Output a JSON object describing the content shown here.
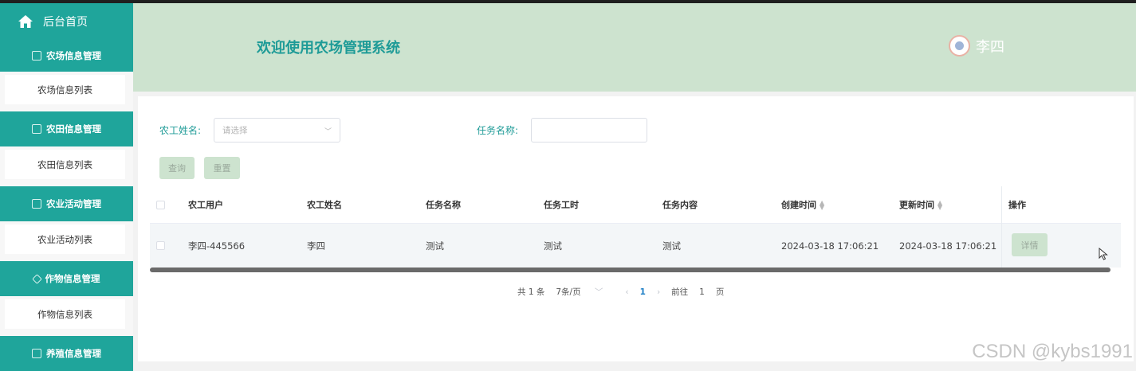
{
  "sidebar": {
    "home_label": "后台首页",
    "groups": [
      {
        "title": "农场信息管理",
        "icon": "edit-icon",
        "item": "农场信息列表"
      },
      {
        "title": "农田信息管理",
        "icon": "chart-icon",
        "item": "农田信息列表"
      },
      {
        "title": "农业活动管理",
        "icon": "edit-icon",
        "item": "农业活动列表"
      },
      {
        "title": "作物信息管理",
        "icon": "gem-icon",
        "item": "作物信息列表"
      },
      {
        "title": "养殖信息管理",
        "icon": "chart-icon"
      }
    ]
  },
  "header": {
    "welcome": "欢迎使用农场管理系统",
    "user_name": "李四"
  },
  "search": {
    "worker_name_label": "农工姓名:",
    "worker_name_placeholder": "请选择",
    "task_name_label": "任务名称:",
    "task_name_value": "",
    "query_label": "查询",
    "reset_label": "重置"
  },
  "table": {
    "columns": [
      "农工用户",
      "农工姓名",
      "任务名称",
      "任务工时",
      "任务内容",
      "创建时间",
      "更新时间",
      "操作"
    ],
    "rows": [
      {
        "user": "李四-445566",
        "name": "李四",
        "task_name": "测试",
        "task_hours": "测试",
        "task_content": "测试",
        "created": "2024-03-18 17:06:21",
        "updated": "2024-03-18 17:06:21",
        "action_label": "详情"
      }
    ]
  },
  "pagination": {
    "total": "共 1 条",
    "page_size": "7条/页",
    "prev": "‹",
    "current": "1",
    "next": "›",
    "goto_prefix": "前往",
    "goto_value": "1",
    "goto_suffix": "页"
  },
  "watermark": "CSDN @kybs1991",
  "colors": {
    "sidebar_accent": "#1fa59b",
    "header_bg": "#cde3cf",
    "title_text": "#1e9b97"
  }
}
